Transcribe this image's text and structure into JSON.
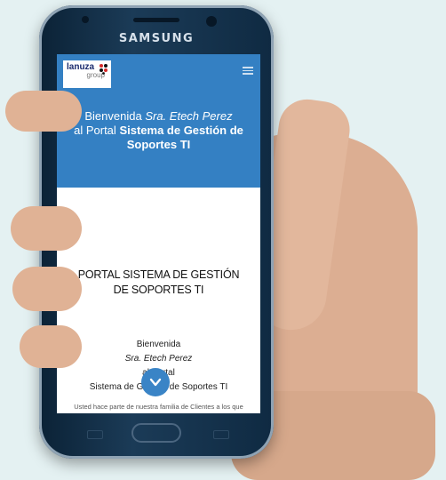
{
  "device": {
    "brand": "SAMSUNG"
  },
  "header": {
    "logo_text": "lanuza",
    "logo_sub": "group",
    "menu_icon": "hamburger-menu-icon",
    "greeting_prefix": "Bienvenida",
    "user_name": "Sra. Etech Perez",
    "portal_prefix": "al Portal",
    "portal_name": "Sistema de Gestión de",
    "portal_name_2": "Soportes TI"
  },
  "main": {
    "title_line1": "PORTAL SISTEMA DE GESTIÓN",
    "title_line2": "DE SOPORTES TI",
    "welcome_prefix": "Bienvenida",
    "welcome_name": "Sra. Etech Perez",
    "welcome_portal_prefix": "al Portal",
    "welcome_portal_name": "Sistema de Gestión de Soportes TI",
    "scroll_icon": "chevron-down-icon",
    "footer_text": "Usted hace parte de nuestra familia de Clientes a los que"
  },
  "colors": {
    "hero_bg": "#3480c3",
    "accent_button": "#3a84c6",
    "background": "#e4f1f2"
  }
}
